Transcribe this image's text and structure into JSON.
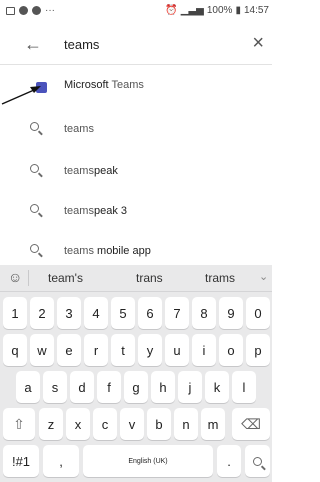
{
  "status_bar": {
    "left_more": "···",
    "battery": "100%",
    "time": "14:57"
  },
  "search": {
    "query": "teams"
  },
  "suggestions": [
    {
      "kind": "app",
      "main": "Microsoft",
      "rest": " Teams"
    },
    {
      "kind": "search",
      "main": "teams",
      "rest": ""
    },
    {
      "kind": "search",
      "main": "teams",
      "rest": "peak"
    },
    {
      "kind": "search",
      "main": "teams",
      "rest": "peak 3"
    },
    {
      "kind": "search",
      "main": "teams",
      "rest": " mobile app"
    }
  ],
  "keyboard": {
    "word_suggestions": [
      "team's",
      "trans",
      "trams"
    ],
    "row1": [
      "1",
      "2",
      "3",
      "4",
      "5",
      "6",
      "7",
      "8",
      "9",
      "0"
    ],
    "row2": [
      "q",
      "w",
      "e",
      "r",
      "t",
      "y",
      "u",
      "i",
      "o",
      "p"
    ],
    "row3": [
      "a",
      "s",
      "d",
      "f",
      "g",
      "h",
      "j",
      "k",
      "l"
    ],
    "row4": [
      "z",
      "x",
      "c",
      "v",
      "b",
      "n",
      "m"
    ],
    "sym_label": "!#1",
    "comma": ",",
    "space_label": "English (UK)",
    "period": "."
  }
}
